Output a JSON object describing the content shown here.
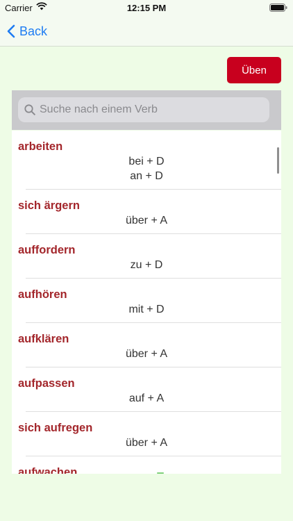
{
  "status_bar": {
    "carrier": "Carrier",
    "time": "12:15 PM"
  },
  "nav": {
    "back_label": "Back"
  },
  "practice_button": {
    "label": "Üben"
  },
  "search": {
    "placeholder": "Suche nach einem Verb",
    "value": ""
  },
  "verbs": [
    {
      "verb": "arbeiten",
      "prepositions": [
        "bei + D",
        "an + D"
      ]
    },
    {
      "verb": "sich ärgern",
      "prepositions": [
        "über + A"
      ]
    },
    {
      "verb": "auffordern",
      "prepositions": [
        "zu + D"
      ]
    },
    {
      "verb": "aufhören",
      "prepositions": [
        "mit + D"
      ]
    },
    {
      "verb": "aufklären",
      "prepositions": [
        "über + A"
      ]
    },
    {
      "verb": "aufpassen",
      "prepositions": [
        "auf + A"
      ]
    },
    {
      "verb": "sich aufregen",
      "prepositions": [
        "über + A"
      ]
    },
    {
      "verb": "aufwachen",
      "prepositions": []
    }
  ],
  "colors": {
    "accent": "#c8001e",
    "verb_text": "#a3262b",
    "link_blue": "#1e7cf2",
    "background": "#eefce6"
  }
}
